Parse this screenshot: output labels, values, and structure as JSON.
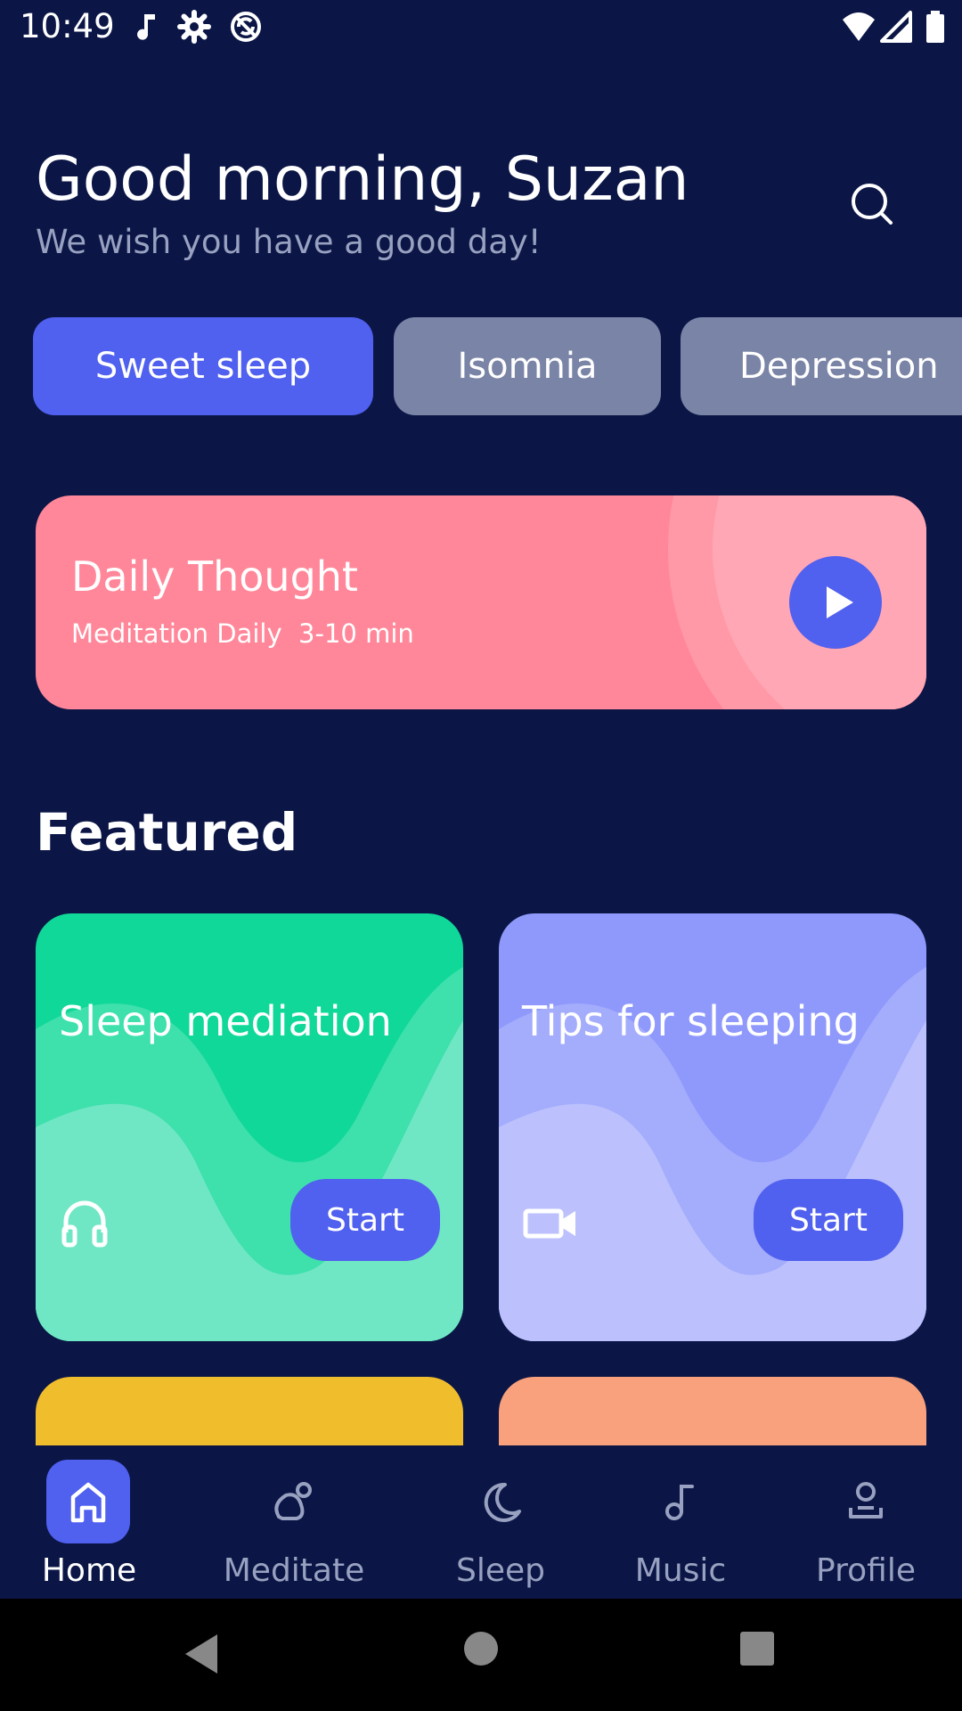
{
  "status_bar": {
    "time": "10:49",
    "left_icons": [
      "music-note-icon",
      "settings-icon",
      "no-sync-icon"
    ],
    "right_icons": [
      "wifi-icon",
      "signal-icon",
      "battery-icon"
    ]
  },
  "header": {
    "greeting": "Good morning, Suzan",
    "subtitle": "We wish you have a good day!",
    "search_icon": "search-icon"
  },
  "categories": [
    {
      "label": "Sweet sleep",
      "active": true
    },
    {
      "label": "Isomnia",
      "active": false
    },
    {
      "label": "Depression",
      "active": false
    }
  ],
  "daily_thought": {
    "title": "Daily Thought",
    "subtitle": "Meditation Daily  3-10 min",
    "play_icon": "play-icon",
    "color": "#ff8799"
  },
  "featured": {
    "heading": "Featured",
    "cards": [
      {
        "title": "Sleep mediation",
        "icon": "headphones-icon",
        "button": "Start",
        "color": "#10d898"
      },
      {
        "title": "Tips for sleeping",
        "icon": "video-camera-icon",
        "button": "Start",
        "color": "#8f99fc"
      }
    ],
    "peek_colors": [
      "#f0bd2c",
      "#f9a07c"
    ]
  },
  "bottom_nav": {
    "items": [
      {
        "label": "Home",
        "icon": "home-icon",
        "active": true
      },
      {
        "label": "Meditate",
        "icon": "meditate-icon",
        "active": false
      },
      {
        "label": "Sleep",
        "icon": "moon-icon",
        "active": false
      },
      {
        "label": "Music",
        "icon": "music-note-icon",
        "active": false
      },
      {
        "label": "Profile",
        "icon": "profile-icon",
        "active": false
      }
    ],
    "active_color": "#5060ef",
    "inactive_color": "#98a1c0"
  },
  "system_nav": {
    "buttons": [
      "back-icon",
      "home-circle-icon",
      "recents-icon"
    ]
  },
  "colors": {
    "background": "#0b1646",
    "accent": "#5060ef"
  }
}
